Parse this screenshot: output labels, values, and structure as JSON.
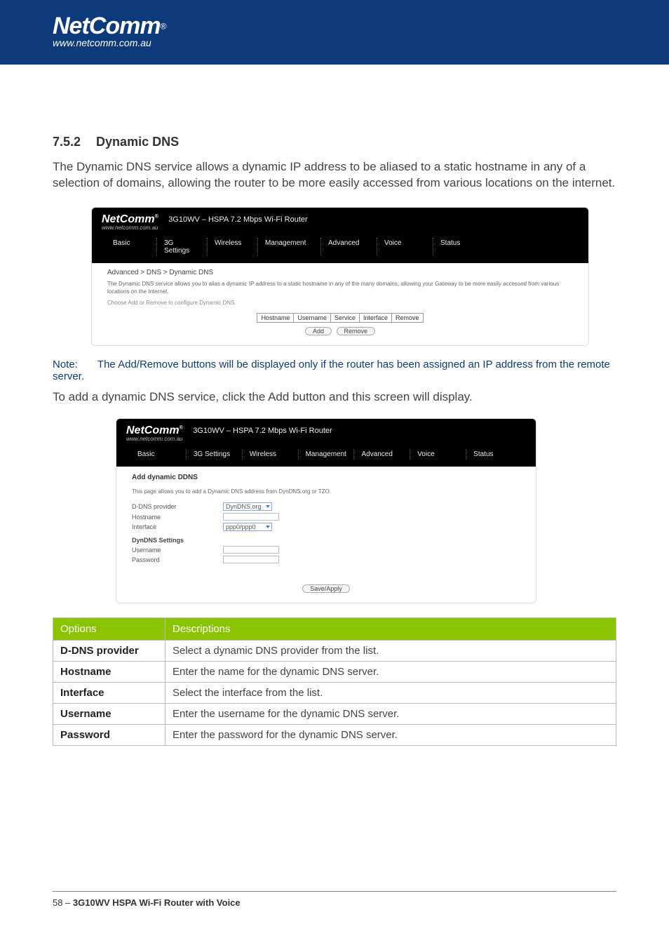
{
  "brand": {
    "name": "NetComm",
    "reg": "®",
    "url": "www.netcomm.com.au"
  },
  "section": {
    "number": "7.5.2",
    "title": "Dynamic DNS",
    "intro": "The Dynamic DNS service allows a dynamic IP address to be aliased to a static hostname in any of a selection of domains, allowing the router to be more easily accessed from various locations on the internet."
  },
  "shot1": {
    "device_title": "3G10WV – HSPA 7.2 Mbps Wi-Fi Router",
    "nav": [
      "Basic",
      "3G Settings",
      "Wireless",
      "Management",
      "Advanced",
      "Voice",
      "Status"
    ],
    "breadcrumb": "Advanced > DNS > Dynamic DNS",
    "desc": "The Dynamic DNS service allows you to alias a dynamic IP address to a static hostname in any of the many domains, allowing your Gateway to be more easily accessed from various locations on the Internet.",
    "hint": "Choose Add or Remove to configure Dynamic DNS.",
    "cols": [
      "Hostname",
      "Username",
      "Service",
      "Interface",
      "Remove"
    ],
    "btn_add": "Add",
    "btn_remove": "Remove"
  },
  "note": {
    "label": "Note:",
    "text": "The Add/Remove buttons will be displayed only if the router has been assigned an IP address from the remote server."
  },
  "add_intro": "To add a dynamic DNS service, click the Add button and this screen will display.",
  "shot2": {
    "device_title": "3G10WV – HSPA 7.2 Mbps Wi-Fi Router",
    "nav": [
      "Basic",
      "3G Settings",
      "Wireless",
      "Management",
      "Advanced",
      "Voice",
      "Status"
    ],
    "heading": "Add dynamic DDNS",
    "subtext": "This page allows you to add a Dynamic DNS address from DynDNS.org or TZO.",
    "fields": {
      "provider_label": "D-DNS provider",
      "provider_value": "DynDNS.org",
      "hostname_label": "Hostname",
      "interface_label": "Interface",
      "interface_value": "ppp0/ppp0",
      "settings_label": "DynDNS Settings",
      "username_label": "Username",
      "password_label": "Password"
    },
    "btn_save": "Save/Apply"
  },
  "options_table": {
    "head_opt": "Options",
    "head_desc": "Descriptions",
    "rows": [
      {
        "opt": "D-DNS provider",
        "desc": "Select a dynamic DNS provider from the list."
      },
      {
        "opt": "Hostname",
        "desc": "Enter the name for the dynamic DNS server."
      },
      {
        "opt": "Interface",
        "desc": "Select the interface from the list."
      },
      {
        "opt": "Username",
        "desc": "Enter the username for the dynamic DNS server."
      },
      {
        "opt": "Password",
        "desc": "Enter the password for the dynamic DNS server."
      }
    ]
  },
  "footer": {
    "page": "58 – ",
    "product": "3G10WV HSPA Wi-Fi Router with Voice"
  }
}
